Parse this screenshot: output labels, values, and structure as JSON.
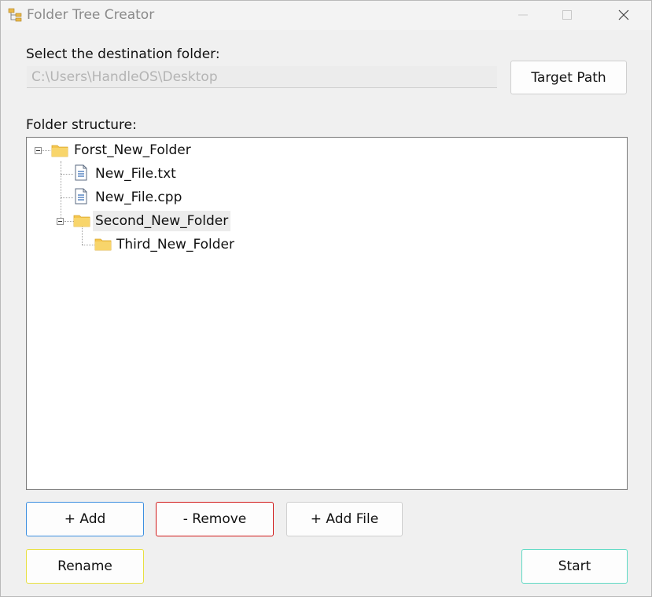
{
  "window": {
    "title": "Folder Tree Creator",
    "icon": "folder-tree-icon"
  },
  "destination": {
    "label": "Select the destination folder:",
    "path": "C:\\Users\\HandleOS\\Desktop",
    "target_button": "Target Path"
  },
  "structure": {
    "label": "Folder structure:",
    "nodes": [
      {
        "label": "Forst_New_Folder",
        "icon": "folder-icon",
        "level": 0,
        "expanded": true
      },
      {
        "label": "New_File.txt",
        "icon": "text-file-icon",
        "level": 1
      },
      {
        "label": "New_File.cpp",
        "icon": "text-file-icon",
        "level": 1
      },
      {
        "label": "Second_New_Folder",
        "icon": "folder-icon",
        "level": 1,
        "expanded": true,
        "selected": true
      },
      {
        "label": "Third_New_Folder",
        "icon": "folder-icon",
        "level": 2
      }
    ]
  },
  "actions": {
    "add": "+ Add",
    "remove": "- Remove",
    "add_file": "+ Add File",
    "rename": "Rename",
    "start": "Start"
  },
  "colors": {
    "add_border": "#3c8fe0",
    "remove_border": "#d11a1a",
    "rename_border": "#e8e040",
    "start_border": "#5fd9c4",
    "folder": "#f2c14e"
  }
}
